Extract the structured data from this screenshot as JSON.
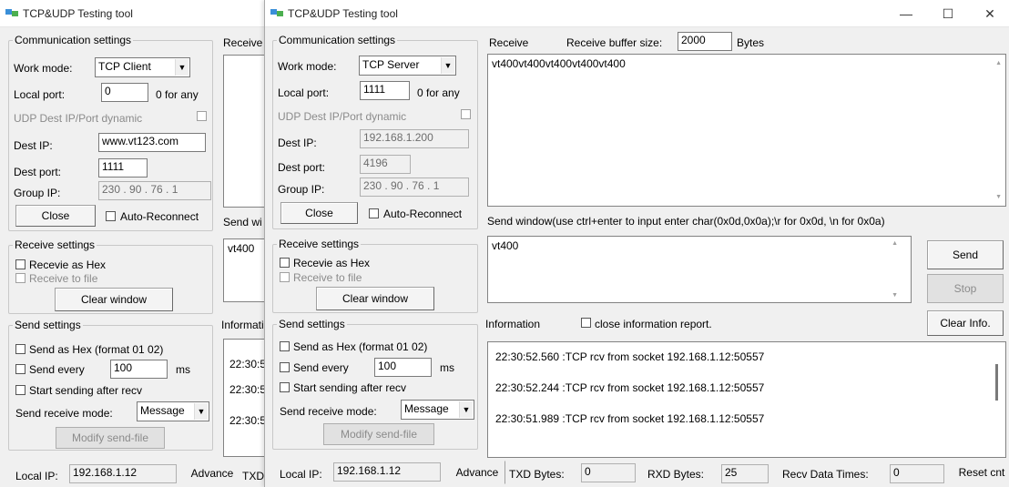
{
  "back_window": {
    "title": "TCP&UDP Testing tool",
    "comm_group": "Communication settings",
    "work_mode_label": "Work mode:",
    "work_mode_value": "TCP Client",
    "local_port_label": "Local port:",
    "local_port_value": "0",
    "local_port_hint": "0 for any",
    "udp_dyn_label": "UDP Dest IP/Port dynamic",
    "dest_ip_label": "Dest IP:",
    "dest_ip_value": "www.vt123.com",
    "dest_port_label": "Dest port:",
    "dest_port_value": "1111",
    "group_ip_label": "Group IP:",
    "group_ip_value": "230 . 90 . 76 . 1",
    "close_button": "Close",
    "auto_reconnect": "Auto-Reconnect",
    "receive_group": "Receive settings",
    "recv_hex": "Recevie as Hex",
    "recv_file": "Receive to file",
    "clear_window": "Clear window",
    "send_group": "Send settings",
    "send_hex": "Send as Hex (format 01 02)",
    "send_every": "Send every",
    "send_every_value": "100",
    "send_every_unit": "ms",
    "start_after_recv": "Start sending after recv",
    "send_recv_mode_label": "Send receive mode:",
    "send_recv_mode_value": "Message",
    "modify_send_file": "Modify send-file",
    "local_ip_label": "Local IP:",
    "local_ip_value": "192.168.1.12",
    "advance": "Advance",
    "receive_cut": "Receive",
    "send_cut": "Send wi",
    "send_text_cut": "vt400",
    "info_cut": "Informati",
    "info_times": [
      "22:30:5",
      "22:30:5",
      "22:30:5"
    ],
    "txd_cut": "TXD"
  },
  "front_window": {
    "title": "TCP&UDP Testing tool",
    "minimize_glyph": "—",
    "maximize_glyph": "☐",
    "close_glyph": "✕",
    "comm_group": "Communication settings",
    "work_mode_label": "Work mode:",
    "work_mode_value": "TCP Server",
    "local_port_label": "Local port:",
    "local_port_value": "1111",
    "local_port_hint": "0 for any",
    "udp_dyn_label": "UDP Dest IP/Port dynamic",
    "dest_ip_label": "Dest IP:",
    "dest_ip_value": "192.168.1.200",
    "dest_port_label": "Dest port:",
    "dest_port_value": "4196",
    "group_ip_label": "Group IP:",
    "group_ip_value": "230 . 90 . 76 . 1",
    "close_button": "Close",
    "auto_reconnect": "Auto-Reconnect",
    "receive_group": "Receive settings",
    "recv_hex": "Recevie as Hex",
    "recv_file": "Receive to file",
    "clear_window": "Clear window",
    "send_group": "Send settings",
    "send_hex": "Send as Hex (format 01 02)",
    "send_every": "Send every",
    "send_every_value": "100",
    "send_every_unit": "ms",
    "start_after_recv": "Start sending after recv",
    "send_recv_mode_label": "Send receive mode:",
    "send_recv_mode_value": "Message",
    "modify_send_file": "Modify send-file",
    "receive_label": "Receive",
    "recv_buffer_label": "Receive buffer size:",
    "recv_buffer_value": "2000",
    "bytes_label": "Bytes",
    "receive_content": "vt400vt400vt400vt400vt400",
    "send_window_label": "Send window(use ctrl+enter to input enter char(0x0d,0x0a);\\r for 0x0d, \\n for 0x0a)",
    "send_content": "vt400",
    "send_button": "Send",
    "stop_button": "Stop",
    "information_label": "Information",
    "close_info_report": "close information report.",
    "clear_info_button": "Clear Info.",
    "info_lines": [
      "22:30:52.560 :TCP rcv from socket 192.168.1.12:50557",
      "22:30:52.244 :TCP rcv from socket 192.168.1.12:50557",
      "22:30:51.989 :TCP rcv from socket 192.168.1.12:50557"
    ],
    "local_ip_label": "Local IP:",
    "local_ip_value": "192.168.1.12",
    "advance": "Advance",
    "txd_label": "TXD Bytes:",
    "txd_value": "0",
    "rxd_label": "RXD Bytes:",
    "rxd_value": "25",
    "recv_times_label": "Recv Data Times:",
    "recv_times_value": "0",
    "reset_cnt": "Reset cnt"
  }
}
